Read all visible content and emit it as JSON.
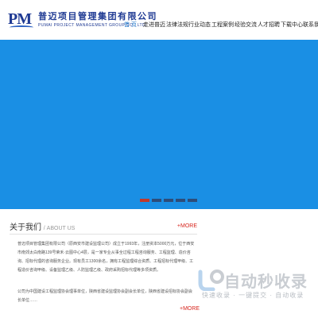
{
  "header": {
    "logo_mark": "PM",
    "logo_cn": "普迈项目管理集团有限公司",
    "logo_en": "PUMAI PROJECT MANAGEMENT GROUP CO., LTD.",
    "nav": [
      {
        "label": "首 页",
        "active": true
      },
      {
        "label": "走进普迈"
      },
      {
        "label": "法律法规"
      },
      {
        "label": "行业动态"
      },
      {
        "label": "工程案例"
      },
      {
        "label": "经验交流"
      },
      {
        "label": "人才招聘"
      },
      {
        "label": "下载中心"
      },
      {
        "label": "联系我们"
      }
    ]
  },
  "banner": {
    "color": "#1a8fe4",
    "slide_count": 5,
    "active_slide": 1
  },
  "about": {
    "title": "关于我们",
    "subtitle": "/ ABOUT US",
    "more": "+MORE",
    "paragraph1": "普迈项目管理集团有限公司（原西安市建设监理公司）成立于1993年，注册资本5000万元，位于西安市南郊太白南路139号荣禾·云图中心4层，是一家专业从事全过程工程咨询服务、工程监理、造价咨询、招标代理的咨询服务企业。现有员工1300余名，拥有工程监理综合资质、工程招标代理甲级、工程造价咨询甲级、设备监理乙级、人防监理乙级、政府采购招标代理等多项资质。",
    "paragraph2": "公司为中国建设工程监理协会理事单位，陕西省建设监理协会副会长单位，陕西省建设招标协会副会长单位……",
    "more2": "+MORE"
  },
  "watermark": {
    "title": "自动秒收录",
    "slogan": "快速收录 · 一键提交 · 自动收录"
  }
}
